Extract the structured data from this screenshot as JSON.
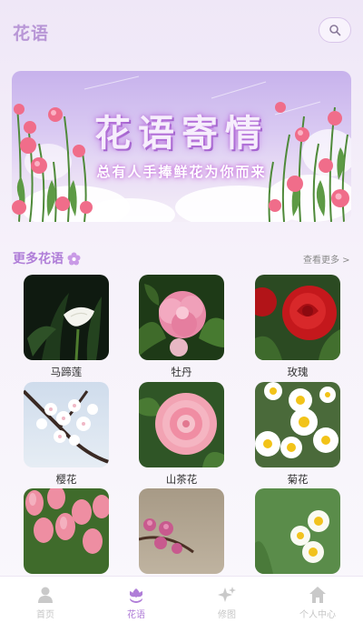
{
  "header": {
    "title": "花语"
  },
  "banner": {
    "title": "花语寄情",
    "subtitle": "总有人手捧鲜花为你而来"
  },
  "section": {
    "title": "更多花语",
    "see_more": "查看更多 >"
  },
  "flowers": [
    {
      "name": "马蹄莲"
    },
    {
      "name": "牡丹"
    },
    {
      "name": "玫瑰"
    },
    {
      "name": "樱花"
    },
    {
      "name": "山茶花"
    },
    {
      "name": "菊花"
    },
    {
      "name": ""
    },
    {
      "name": ""
    },
    {
      "name": ""
    }
  ],
  "tabs": [
    {
      "label": "首页",
      "icon": "person-icon"
    },
    {
      "label": "花语",
      "icon": "flower-icon"
    },
    {
      "label": "修图",
      "icon": "sparkle-icon"
    },
    {
      "label": "个人中心",
      "icon": "home-icon"
    }
  ],
  "colors": {
    "accent": "#b07ed8",
    "inactive": "#c6c6c6"
  }
}
